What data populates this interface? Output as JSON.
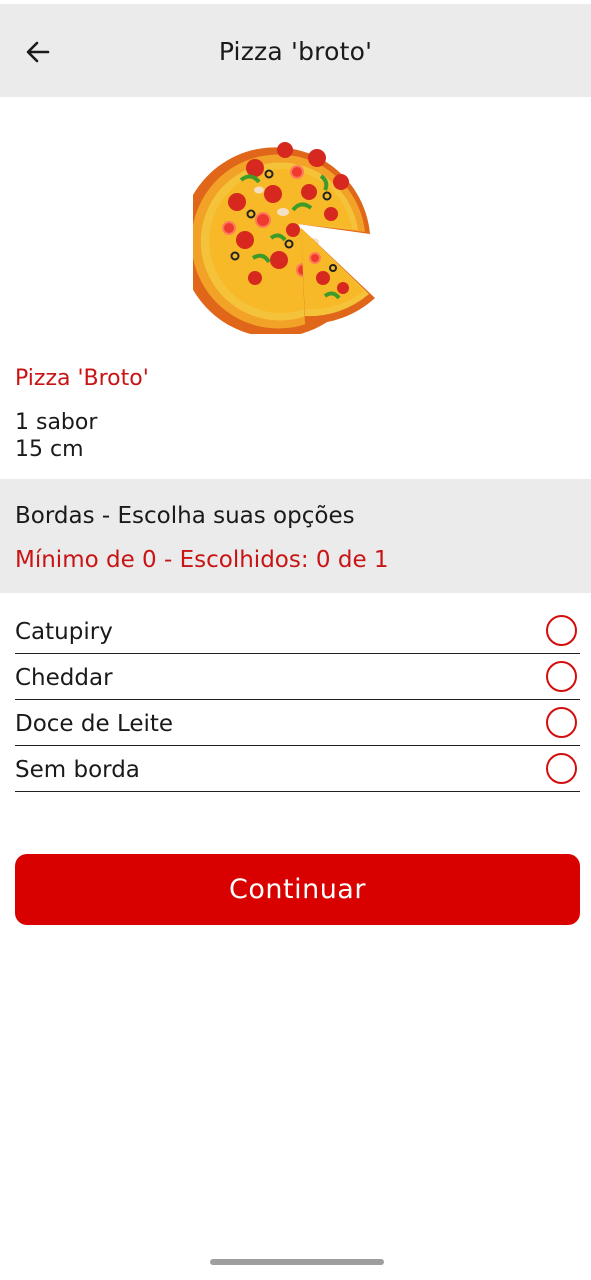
{
  "header": {
    "back_icon": "arrow-left-icon",
    "title": "Pizza 'broto'"
  },
  "product": {
    "image_icon": "pizza-image",
    "name": "Pizza 'Broto'",
    "desc_line1": "1 sabor",
    "desc_line2": "15 cm"
  },
  "bordas": {
    "title": "Bordas - Escolha suas opções",
    "subtitle": "Mínimo de 0 - Escolhidos: 0 de 1",
    "options": [
      {
        "label": "Catupiry",
        "selected": false
      },
      {
        "label": "Cheddar",
        "selected": false
      },
      {
        "label": "Doce de Leite",
        "selected": false
      },
      {
        "label": "Sem borda",
        "selected": false
      }
    ]
  },
  "actions": {
    "continue_label": "Continuar"
  },
  "colors": {
    "accent": "#d90000",
    "header_bg": "#ebebeb"
  }
}
